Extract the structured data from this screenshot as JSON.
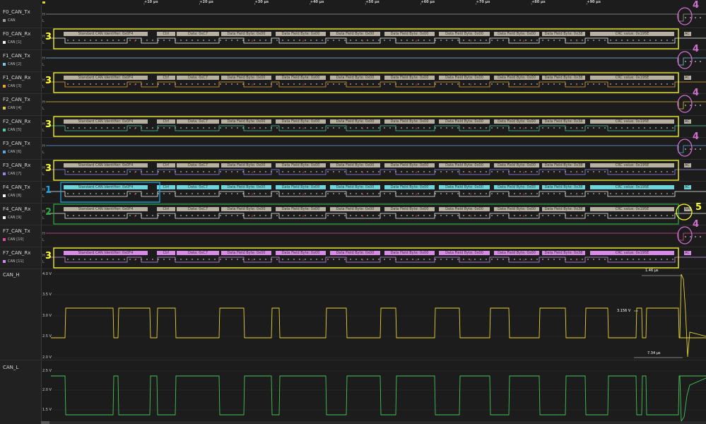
{
  "time_ruler": {
    "ticks": [
      "+10 µs",
      "+20 µs",
      "+30 µs",
      "+40 µs",
      "+50 µs",
      "+60 µs",
      "+70 µs",
      "+80 µs",
      "+90 µs"
    ]
  },
  "level_marks": {
    "high": "H",
    "low": "L"
  },
  "channels": [
    {
      "name": "F0_CAN_Tx",
      "sub": "CAN",
      "kind": "tx",
      "color": "#9a9a9a",
      "callout": "4"
    },
    {
      "name": "F0_CAN_Rx",
      "sub": "CAN [1]",
      "kind": "rx",
      "color": "#f2f2f2",
      "callout": "3",
      "box_color": "#ffff33"
    },
    {
      "name": "F1_CAN_Tx",
      "sub": "CAN [2]",
      "kind": "tx",
      "color": "#7ec8e3",
      "callout": "4"
    },
    {
      "name": "F1_CAN_Rx",
      "sub": "CAN [3]",
      "kind": "rx",
      "color": "#e8a33a",
      "callout": "3",
      "box_color": "#ffff33"
    },
    {
      "name": "F2_CAN_Tx",
      "sub": "CAN [4]",
      "kind": "tx",
      "color": "#e0c341",
      "callout": "4"
    },
    {
      "name": "F2_CAN_Rx",
      "sub": "CAN [5]",
      "kind": "rx",
      "color": "#4ec9a0",
      "callout": "3",
      "box_color": "#ffff33"
    },
    {
      "name": "F3_CAN_Tx",
      "sub": "CAN [6]",
      "kind": "tx",
      "color": "#5aa8e0",
      "callout": "4"
    },
    {
      "name": "F3_CAN_Rx",
      "sub": "CAN [7]",
      "kind": "rx",
      "color": "#8f88e8",
      "callout": "3",
      "box_color": "#ffff33"
    },
    {
      "name": "F4_CAN_Tx",
      "sub": "CAN [8]",
      "kind": "txframe",
      "color": "#f2f2f2",
      "callout": "1",
      "box_color": "#1aa3e6"
    },
    {
      "name": "F4_CAN_Rx",
      "sub": "CAN [9]",
      "kind": "rx",
      "color": "#f2f2f2",
      "callout": "2",
      "box_color": "#2ea043",
      "end_callout": "5"
    },
    {
      "name": "F7_CAN_Tx",
      "sub": "CAN [10]",
      "kind": "tx",
      "color": "#e04aa0",
      "callout": "4"
    },
    {
      "name": "F7_CAN_Rx",
      "sub": "CAN [11]",
      "kind": "rx",
      "color": "#d08ef0",
      "callout": "3",
      "box_color": "#ffff33"
    }
  ],
  "decode_segments": [
    "Standard CAN Identifier: 0x0F4",
    "Ctrl",
    "Data: 0xC7",
    "Data Field Byte: 0x00",
    "Data Field Byte: 0x00",
    "Data Field Byte: 0x00",
    "Data Field Byte: 0x00",
    "Data Field Byte: 0x00",
    "Data Field Byte: 0x00",
    "Data Field Byte: 0x38",
    "CRC value: 0x195E"
  ],
  "decode_end_tags": [
    "AC",
    "AC",
    "AC",
    "AC",
    "AC",
    "NA",
    "AC",
    "AC"
  ],
  "decode_colors": {
    "normal": "#b8b0a0",
    "highlight": "#6fd3dc",
    "f7": "#d98ae6"
  },
  "analog": {
    "can_h": {
      "name": "CAN_H",
      "color": "#e6d33a",
      "volts": [
        "4.0 V",
        "3.5 V",
        "3.0 V",
        "2.5 V",
        "2.0 V"
      ]
    },
    "can_l": {
      "name": "CAN_L",
      "color": "#44c35a",
      "volts": [
        "2.5 V",
        "2.0 V",
        "1.5 V"
      ]
    }
  },
  "measurements": {
    "width_top": "1.46 µs",
    "width_bottom": "7.34 µs",
    "level": "3.156 V"
  },
  "colors": {
    "callout_yellow": "#ffff33",
    "callout_pink": "#d070d0",
    "callout_blue": "#1aa3e6",
    "callout_green": "#2ea043"
  }
}
